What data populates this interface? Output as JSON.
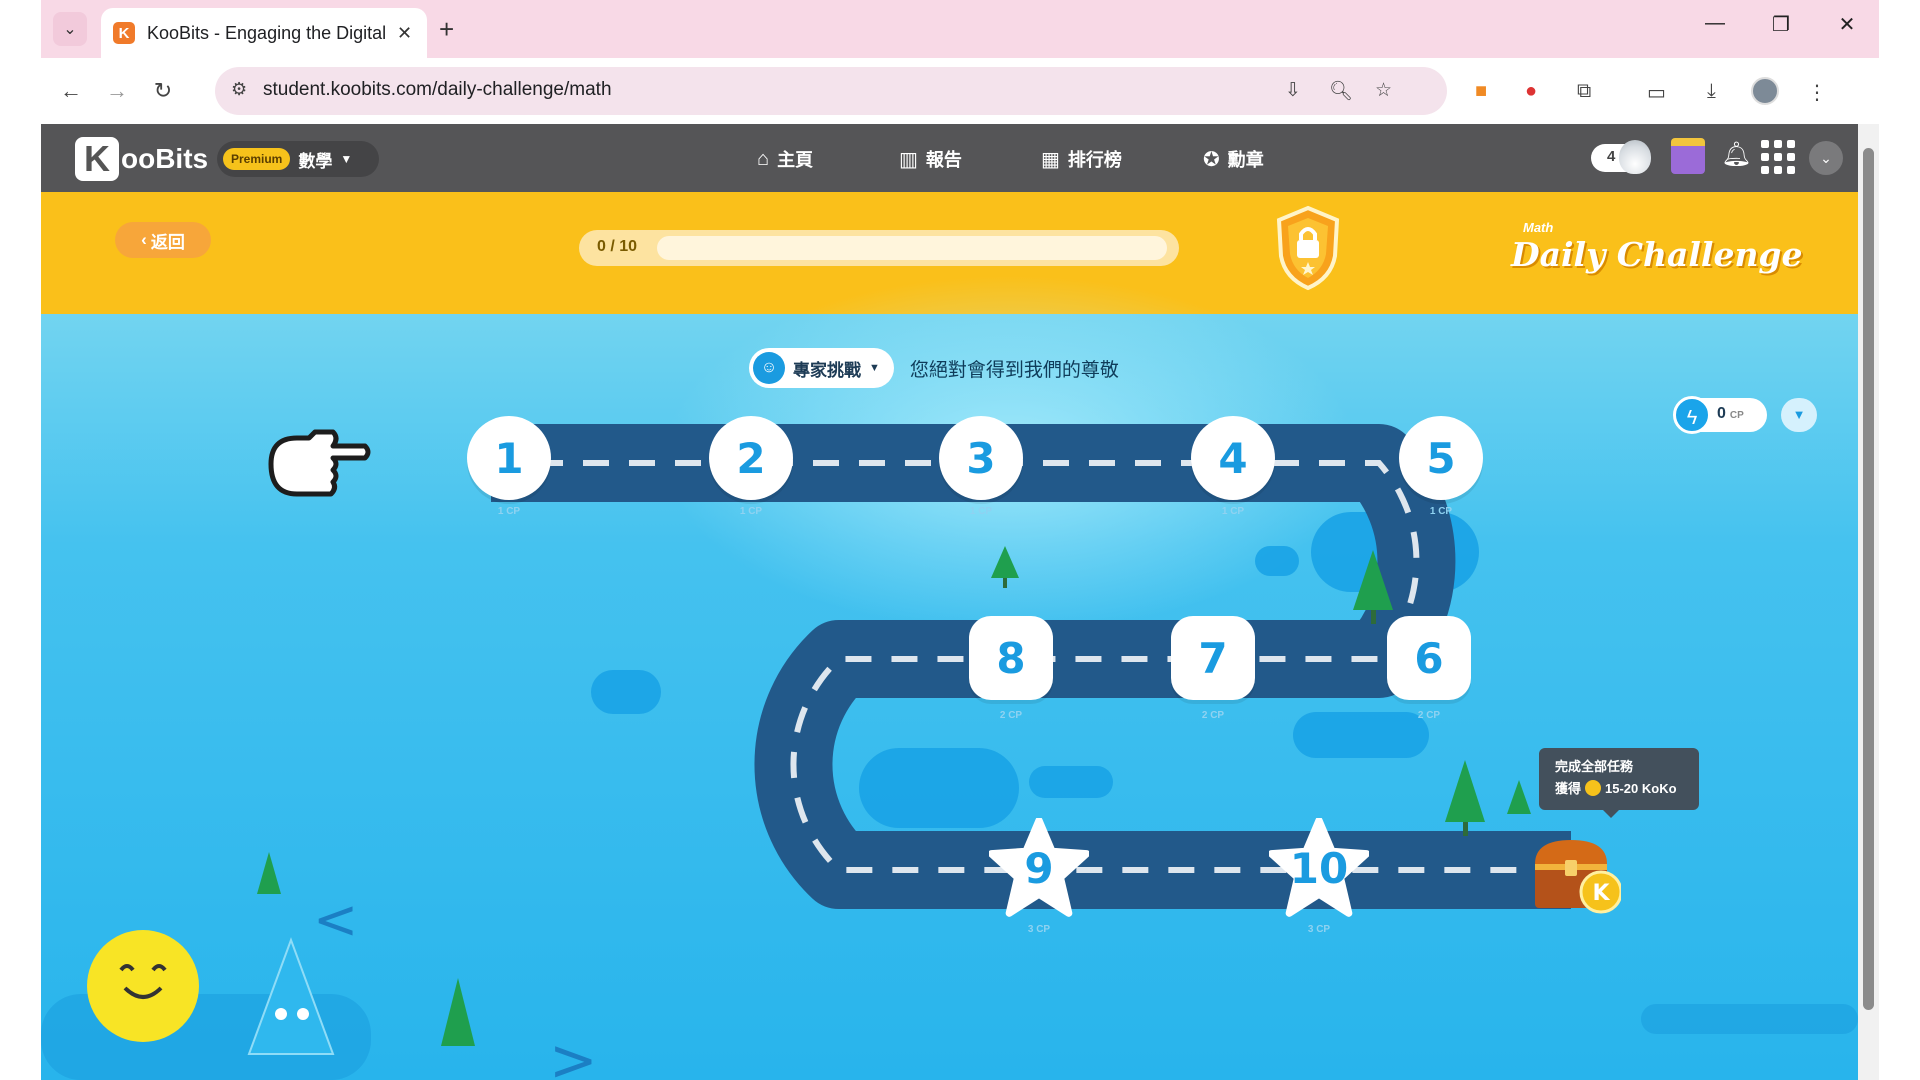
{
  "browser": {
    "tab_title": "KooBits - Engaging the Digital H",
    "url": "student.koobits.com/daily-challenge/math",
    "window_controls": [
      "minimize",
      "restore",
      "close"
    ]
  },
  "header": {
    "logo_k": "K",
    "logo_text": "ooBits",
    "premium_label": "Premium",
    "subject": "數學",
    "nav": [
      {
        "label": "主頁",
        "icon": "home-icon"
      },
      {
        "label": "報告",
        "icon": "bar-chart-icon"
      },
      {
        "label": "排行榜",
        "icon": "leaderboard-icon"
      },
      {
        "label": "勳章",
        "icon": "badge-icon"
      }
    ],
    "flame_count": "4"
  },
  "challenge_bar": {
    "back_label": "返回",
    "progress_text": "0 / 10",
    "progress_fraction": 0.0,
    "title_small": "Math",
    "title_big": "Daily Challenge"
  },
  "map": {
    "mode_label": "專家挑戰",
    "mode_desc": "您絕對會得到我們的尊敬",
    "cp_value": "0",
    "cp_unit": "CP",
    "tooltip_line1": "完成全部任務",
    "tooltip_line2_prefix": "獲得",
    "tooltip_line2_suffix": "15-20 KoKo",
    "chest_coin": "K",
    "nodes": [
      {
        "n": "1",
        "cp": "1 CP"
      },
      {
        "n": "2",
        "cp": "1 CP"
      },
      {
        "n": "3",
        "cp": "1 CP"
      },
      {
        "n": "4",
        "cp": "1 CP"
      },
      {
        "n": "5",
        "cp": "1 CP"
      },
      {
        "n": "6",
        "cp": "2 CP"
      },
      {
        "n": "7",
        "cp": "2 CP"
      },
      {
        "n": "8",
        "cp": "2 CP"
      },
      {
        "n": "9",
        "cp": "3 CP"
      },
      {
        "n": "10",
        "cp": "3 CP"
      }
    ]
  },
  "colors": {
    "header_bg": "#555557",
    "challenge_bar": "#fac01a",
    "map_sky": "#45c2ef",
    "road": "#22598a",
    "node_text": "#1a9be0"
  }
}
